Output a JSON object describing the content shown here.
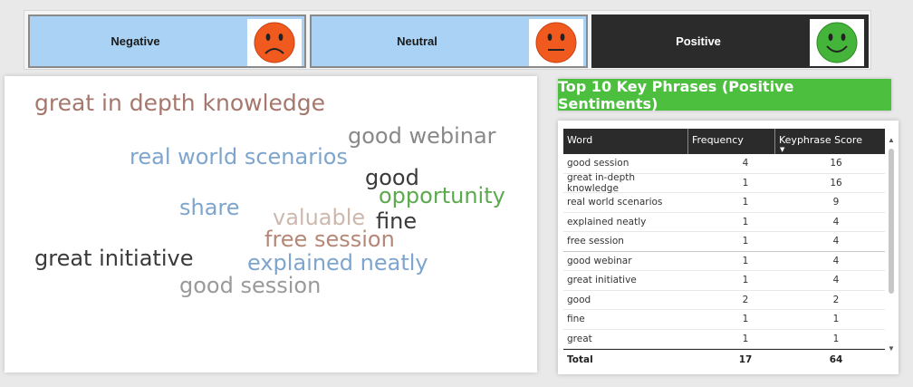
{
  "sentiment_tiles": {
    "negative": {
      "label": "Negative",
      "icon": "sad-face-icon",
      "color": "#f15a1f"
    },
    "neutral": {
      "label": "Neutral",
      "icon": "neutral-face-icon",
      "color": "#f15a1f"
    },
    "positive": {
      "label": "Positive",
      "icon": "happy-face-icon",
      "color": "#44b53a"
    }
  },
  "word_cloud": {
    "words": [
      {
        "text": "great in depth knowledge",
        "color": "#a5776d"
      },
      {
        "text": "good webinar",
        "color": "#888888"
      },
      {
        "text": "real world scenarios",
        "color": "#7ea5cd"
      },
      {
        "text": "good",
        "color": "#3a3a3a"
      },
      {
        "text": "opportunity",
        "color": "#5caa4e"
      },
      {
        "text": "share",
        "color": "#7ea5cd"
      },
      {
        "text": "valuable",
        "color": "#cdb8ad"
      },
      {
        "text": "fine",
        "color": "#3a3a3a"
      },
      {
        "text": "free session",
        "color": "#b58777"
      },
      {
        "text": "great initiative",
        "color": "#3a3a3a"
      },
      {
        "text": "explained neatly",
        "color": "#7ea5cd"
      },
      {
        "text": "good session",
        "color": "#9a9a9a"
      }
    ]
  },
  "key_phrases": {
    "title": "Top 10 Key Phrases (Positive Sentiments)",
    "columns": [
      "Word",
      "Frequency",
      "Keyphrase Score"
    ],
    "rows": [
      {
        "word": "good session",
        "frequency": "4",
        "score": "16"
      },
      {
        "word": "great in-depth knowledge",
        "frequency": "1",
        "score": "16"
      },
      {
        "word": "real world scenarios",
        "frequency": "1",
        "score": "9"
      },
      {
        "word": "explained neatly",
        "frequency": "1",
        "score": "4"
      },
      {
        "word": "free session",
        "frequency": "1",
        "score": "4"
      },
      {
        "word": "good webinar",
        "frequency": "1",
        "score": "4"
      },
      {
        "word": "great initiative",
        "frequency": "1",
        "score": "4"
      },
      {
        "word": "good",
        "frequency": "2",
        "score": "2"
      },
      {
        "word": "fine",
        "frequency": "1",
        "score": "1"
      },
      {
        "word": "great",
        "frequency": "1",
        "score": "1"
      }
    ],
    "total": {
      "label": "Total",
      "frequency": "17",
      "score": "64"
    }
  }
}
